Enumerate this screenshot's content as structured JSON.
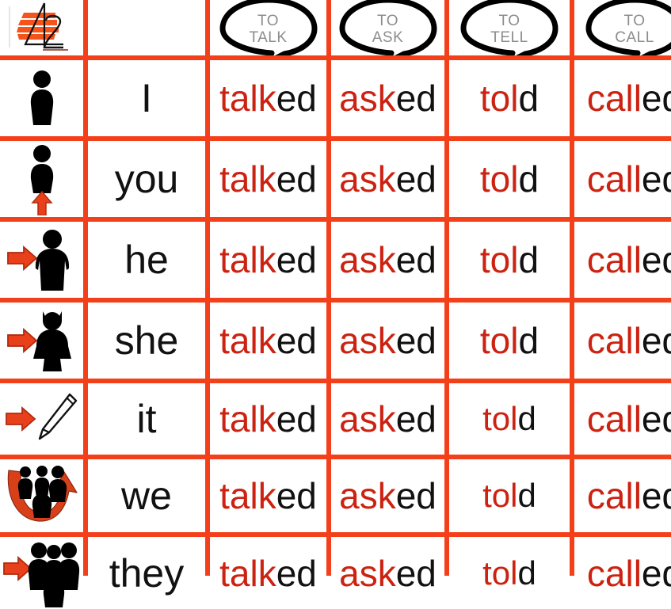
{
  "table": {
    "logo": {
      "name": "logo-42",
      "text": "42"
    },
    "header": {
      "pronoun_header": "",
      "verbs": [
        {
          "line1": "TO",
          "line2": "TALK",
          "icon": "speech-bubble-icon"
        },
        {
          "line1": "TO",
          "line2": "ASK",
          "icon": "speech-bubble-icon"
        },
        {
          "line1": "TO",
          "line2": "TELL",
          "icon": "speech-bubble-icon"
        },
        {
          "line1": "TO",
          "line2": "CALL",
          "icon": "speech-bubble-icon"
        }
      ]
    },
    "rows": [
      {
        "icon": "person-self-icon",
        "pronoun": "I",
        "forms": [
          {
            "stem": "talk",
            "suffix": "ed"
          },
          {
            "stem": "ask",
            "suffix": "ed"
          },
          {
            "stem": "tol",
            "suffix": "d"
          },
          {
            "stem": "call",
            "suffix": "ed"
          }
        ]
      },
      {
        "icon": "person-arrow-up-icon",
        "pronoun": "you",
        "forms": [
          {
            "stem": "talk",
            "suffix": "ed"
          },
          {
            "stem": "ask",
            "suffix": "ed"
          },
          {
            "stem": "tol",
            "suffix": "d"
          },
          {
            "stem": "call",
            "suffix": "ed"
          }
        ]
      },
      {
        "icon": "man-arrow-right-icon",
        "pronoun": "he",
        "forms": [
          {
            "stem": "talk",
            "suffix": "ed"
          },
          {
            "stem": "ask",
            "suffix": "ed"
          },
          {
            "stem": "tol",
            "suffix": "d"
          },
          {
            "stem": "call",
            "suffix": "ed"
          }
        ]
      },
      {
        "icon": "woman-arrow-right-icon",
        "pronoun": "she",
        "forms": [
          {
            "stem": "talk",
            "suffix": "ed"
          },
          {
            "stem": "ask",
            "suffix": "ed"
          },
          {
            "stem": "tol",
            "suffix": "d"
          },
          {
            "stem": "call",
            "suffix": "ed"
          }
        ]
      },
      {
        "icon": "pencil-arrow-right-icon",
        "pronoun": "it",
        "forms": [
          {
            "stem": "talk",
            "suffix": "ed"
          },
          {
            "stem": "ask",
            "suffix": "ed"
          },
          {
            "stem": "tol",
            "suffix": "d"
          },
          {
            "stem": "call",
            "suffix": "ed"
          }
        ]
      },
      {
        "icon": "group-curved-arrow-icon",
        "pronoun": "we",
        "forms": [
          {
            "stem": "talk",
            "suffix": "ed"
          },
          {
            "stem": "ask",
            "suffix": "ed"
          },
          {
            "stem": "tol",
            "suffix": "d"
          },
          {
            "stem": "call",
            "suffix": "ed"
          }
        ]
      },
      {
        "icon": "group-arrow-right-icon",
        "pronoun": "they",
        "forms": [
          {
            "stem": "talk",
            "suffix": "ed"
          },
          {
            "stem": "ask",
            "suffix": "ed"
          },
          {
            "stem": "tol",
            "suffix": "d"
          },
          {
            "stem": "call",
            "suffix": "ed"
          }
        ]
      }
    ]
  },
  "colors": {
    "grid_border": "#f4401a",
    "stem_red": "#cc2211",
    "text_black": "#111111",
    "bubble_gray": "#8d8d8d",
    "icon_black": "#000000",
    "arrow_red": "#e8401a"
  }
}
